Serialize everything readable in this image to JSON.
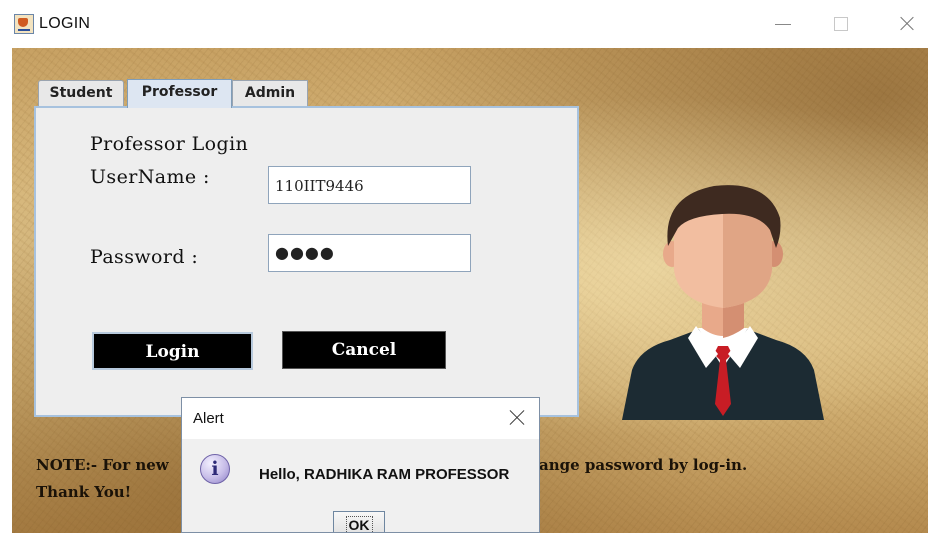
{
  "window": {
    "title": "LOGIN"
  },
  "tabs": [
    {
      "label": "Student"
    },
    {
      "label": "Professor",
      "selected": true
    },
    {
      "label": "Admin"
    }
  ],
  "form": {
    "heading": "Professor Login",
    "username_label": "UserName :",
    "username_value": "110IIT9446",
    "password_label": "Password :",
    "password_value_masked": "●●●●",
    "login_label": "Login",
    "cancel_label": "Cancel"
  },
  "note": {
    "line1_start": "NOTE:- For new",
    "line1_end": "ange password by log-in.",
    "line2": "Thank You!"
  },
  "dialog": {
    "title": "Alert",
    "icon_glyph": "i",
    "icon": "info-icon",
    "message": "Hello, RADHIKA RAM PROFESSOR",
    "ok_label": "OK"
  },
  "colors": {
    "selected_tab": "#dde6f2",
    "button_bg": "#000000",
    "panel_bg": "#eeeeee"
  }
}
